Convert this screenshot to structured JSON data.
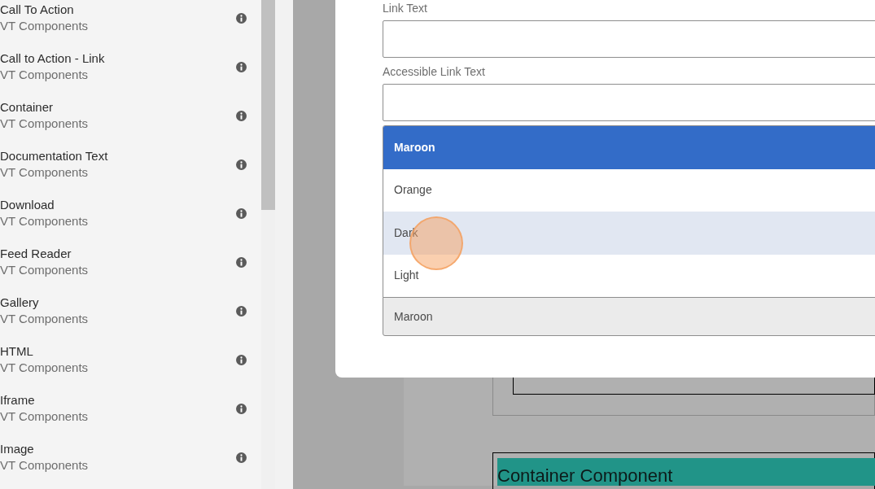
{
  "sidebar": {
    "items": [
      {
        "title": "Call To Action",
        "subtitle": "VT Components"
      },
      {
        "title": "Call to Action - Link",
        "subtitle": "VT Components"
      },
      {
        "title": "Container",
        "subtitle": "VT Components"
      },
      {
        "title": "Documentation Text",
        "subtitle": "VT Components"
      },
      {
        "title": "Download",
        "subtitle": "VT Components"
      },
      {
        "title": "Feed Reader",
        "subtitle": "VT Components"
      },
      {
        "title": "Gallery",
        "subtitle": "VT Components"
      },
      {
        "title": "HTML",
        "subtitle": "VT Components"
      },
      {
        "title": "Iframe",
        "subtitle": "VT Components"
      },
      {
        "title": "Image",
        "subtitle": "VT Components"
      }
    ]
  },
  "dialog": {
    "fields": [
      {
        "label": "Link Text"
      },
      {
        "label": "Accessible Link Text"
      }
    ],
    "dropdown": {
      "options": [
        {
          "label": "Maroon",
          "selected": true,
          "hovered": false
        },
        {
          "label": "Orange",
          "selected": false,
          "hovered": false
        },
        {
          "label": "Dark",
          "selected": false,
          "hovered": true
        },
        {
          "label": "Light",
          "selected": false,
          "hovered": false
        }
      ],
      "value": "Maroon"
    }
  },
  "page": {
    "heading": "Container Component"
  }
}
